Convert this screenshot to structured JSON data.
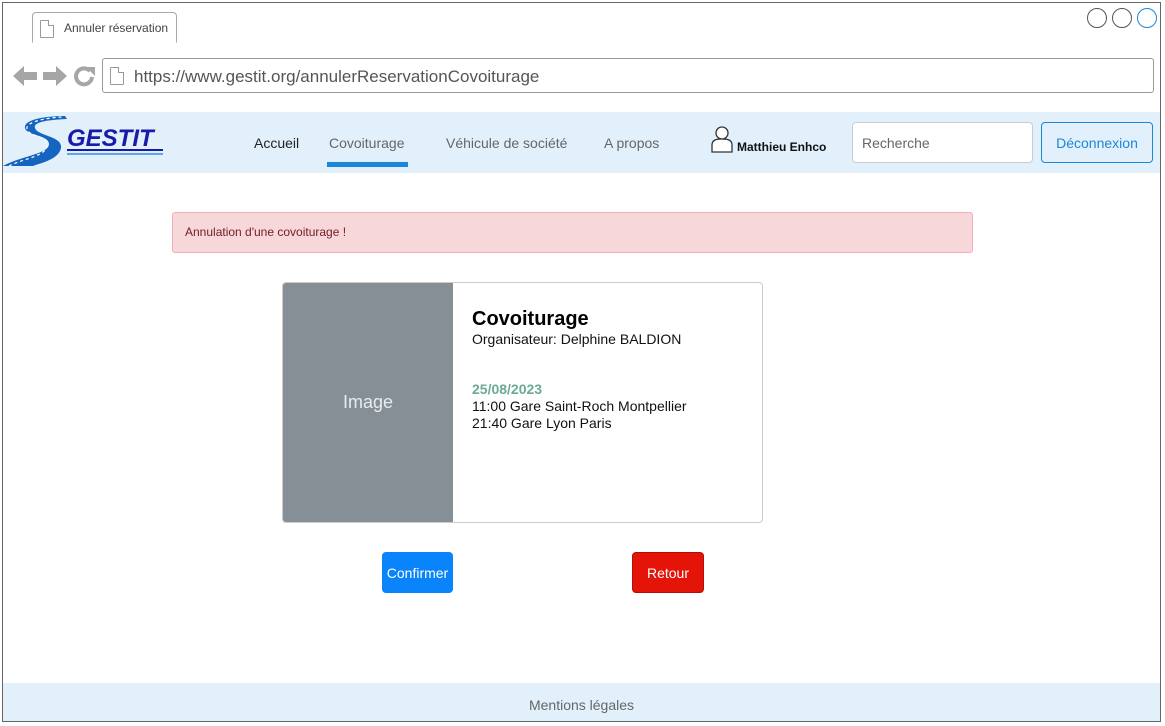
{
  "browser": {
    "tab_title": "Annuler réservation",
    "url": "https://www.gestit.org/annulerReservationCovoiturage"
  },
  "navbar": {
    "logo_text": "GESTIT",
    "links": [
      {
        "label": "Accueil",
        "active": false
      },
      {
        "label": "Covoiturage",
        "active": true
      },
      {
        "label": "Véhicule de société",
        "active": false
      },
      {
        "label": "A propos",
        "active": false
      }
    ],
    "user_name": "Matthieu Enhco",
    "search_placeholder": "Recherche",
    "logout_label": "Déconnexion"
  },
  "alert": {
    "message": "Annulation d'une covoiturage !"
  },
  "card": {
    "image_placeholder": "Image",
    "title": "Covoiturage",
    "organizer": "Organisateur: Delphine BALDION",
    "date": "25/08/2023",
    "departure": "11:00 Gare Saint-Roch Montpellier",
    "arrival": "21:40 Gare Lyon Paris"
  },
  "actions": {
    "confirm_label": "Confirmer",
    "back_label": "Retour"
  },
  "footer": {
    "legal_label": "Mentions légales"
  },
  "colors": {
    "primary": "#1a87d9",
    "navbar_bg": "#e1f0fb",
    "confirm": "#0a84fa",
    "danger": "#e51409",
    "alert_bg": "#f8d7da",
    "date": "#6aaa96"
  }
}
